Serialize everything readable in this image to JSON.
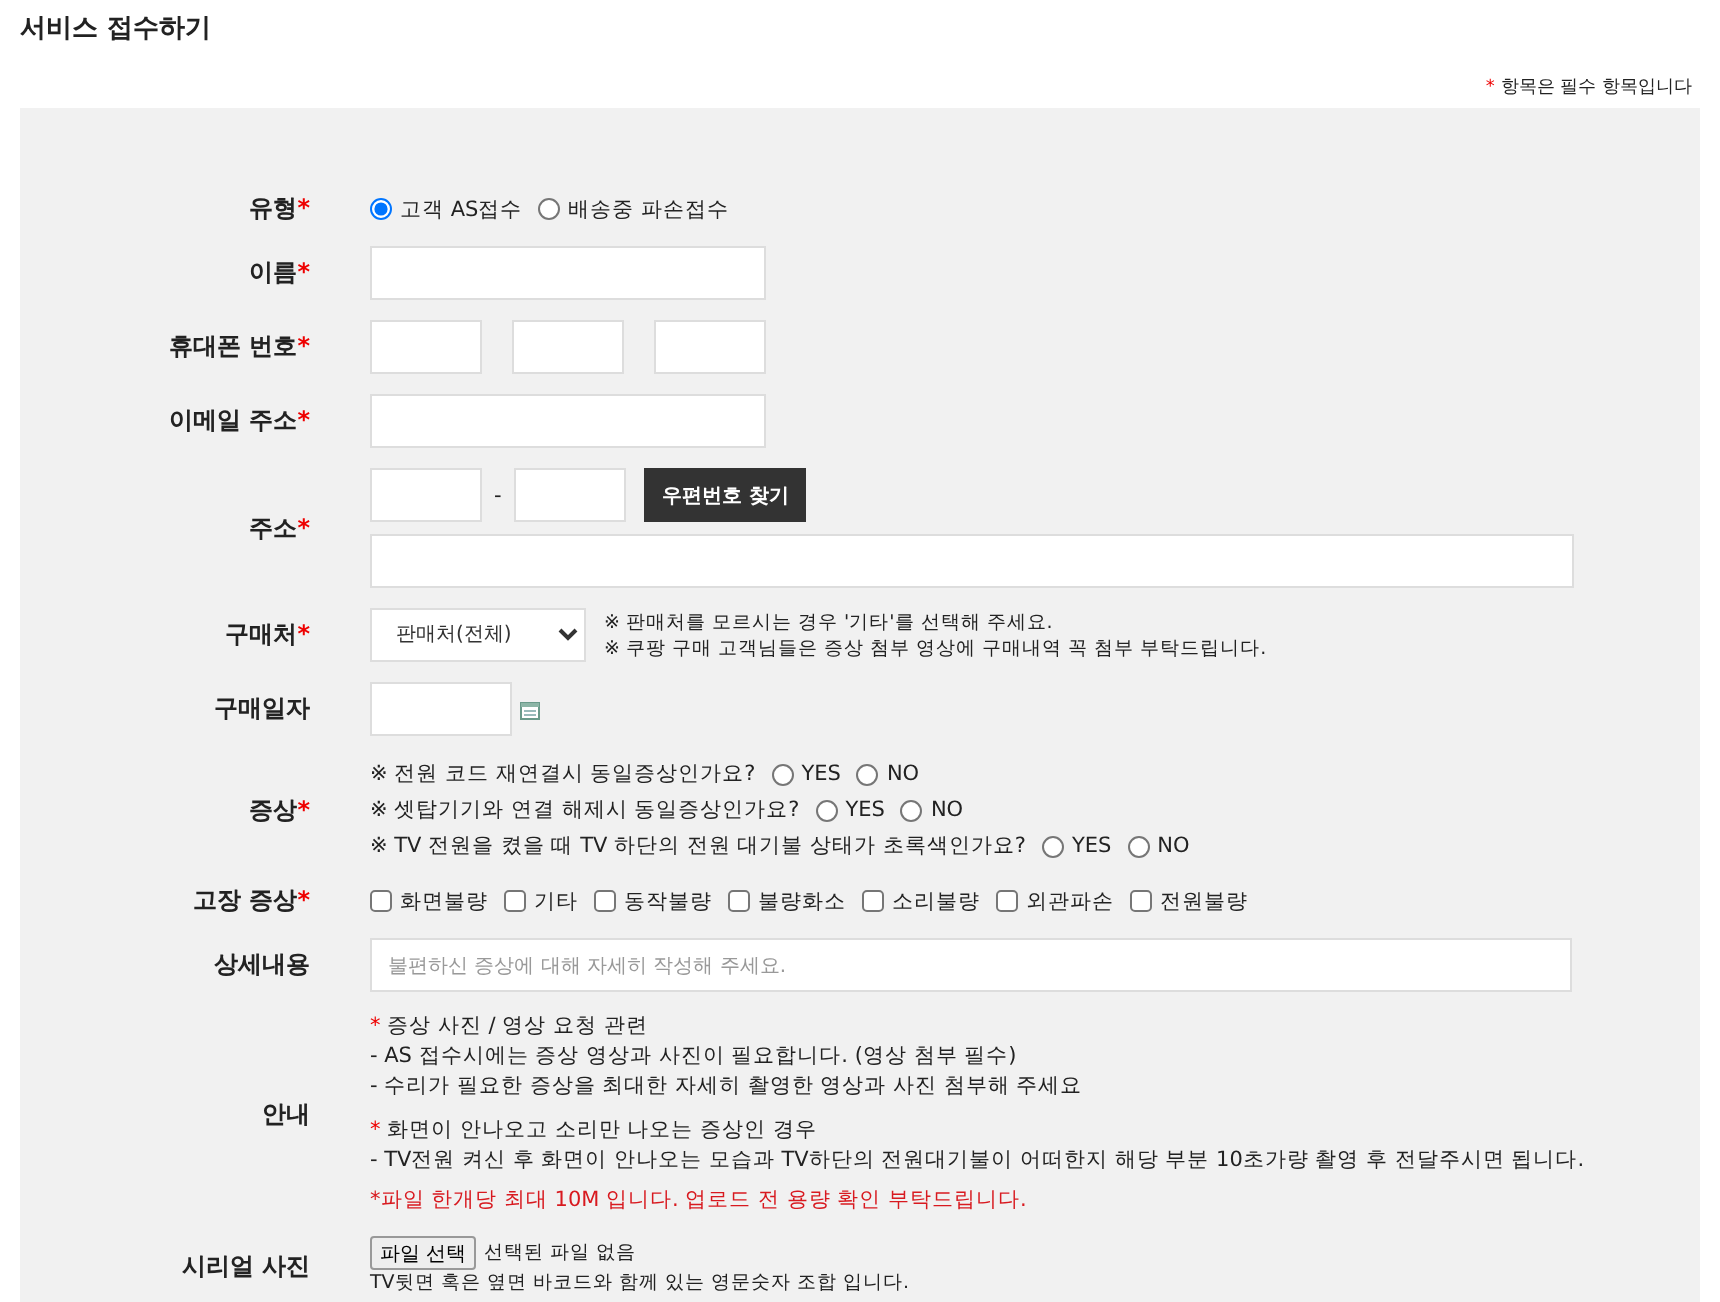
{
  "title": "서비스 접수하기",
  "required_note": {
    "mark": "*",
    "text": "항목은 필수 항목입니다"
  },
  "rows": [
    {
      "kind": "radio",
      "label": "유형",
      "mark": "*",
      "options": [
        {
          "label": "고객 AS접수",
          "selected": true
        },
        {
          "label": "배송중 파손접수",
          "selected": false
        }
      ]
    },
    {
      "kind": "text",
      "label": "이름",
      "mark": "*"
    },
    {
      "kind": "phone",
      "label": "휴대폰 번호",
      "mark": "*"
    },
    {
      "kind": "text",
      "label": "이메일 주소",
      "mark": "*"
    },
    {
      "kind": "address",
      "label": "주소",
      "mark": "*",
      "separator": "-",
      "button": "우편번호 찾기"
    },
    {
      "kind": "select",
      "label": "구매처",
      "mark": "*",
      "value": "판매처(전체)",
      "notes": [
        "※ 판매처를 모르시는 경우 '기타'를 선택해 주세요.",
        "※ 쿠팡 구매 고객님들은 증상 첨부 영상에 구매내역 꼭 첨부 부탁드립니다."
      ]
    },
    {
      "kind": "date",
      "label": "구매일자"
    },
    {
      "kind": "questions",
      "label": "증상",
      "mark": "*",
      "questions": [
        {
          "text": "※ 전원 코드 재연결시 동일증상인가요?",
          "options": [
            {
              "label": "YES",
              "selected": false
            },
            {
              "label": "NO",
              "selected": false
            }
          ]
        },
        {
          "text": "※ 셋탑기기와 연결 해제시 동일증상인가요?",
          "options": [
            {
              "label": "YES",
              "selected": false
            },
            {
              "label": "NO",
              "selected": false
            }
          ]
        },
        {
          "text": "※ TV 전원을 켰을 때 TV 하단의 전원 대기불 상태가 초록색인가요?",
          "options": [
            {
              "label": "YES",
              "selected": false
            },
            {
              "label": "NO",
              "selected": false
            }
          ]
        }
      ]
    },
    {
      "kind": "checkboxes",
      "label": "고장 증상",
      "mark": "*",
      "options": [
        {
          "label": "화면불량",
          "checked": false
        },
        {
          "label": "기타",
          "checked": false
        },
        {
          "label": "동작불량",
          "checked": false
        },
        {
          "label": "불량화소",
          "checked": false
        },
        {
          "label": "소리불량",
          "checked": false
        },
        {
          "label": "외관파손",
          "checked": false
        },
        {
          "label": "전원불량",
          "checked": false
        }
      ]
    },
    {
      "kind": "textarea",
      "label": "상세내용",
      "placeholder": "불편하신 증상에 대해 자세히 작성해 주세요."
    },
    {
      "kind": "notice",
      "label": "안내",
      "blocks": [
        {
          "mark": "*",
          "heading": "증상 사진 / 영상 요청 관련",
          "lines": [
            "- AS 접수시에는 증상 영상과 사진이 필요합니다. (영상 첨부 필수)",
            "- 수리가 필요한 증상을 최대한 자세히 촬영한 영상과 사진 첨부해 주세요"
          ]
        },
        {
          "mark": "*",
          "heading": "화면이 안나오고 소리만 나오는 증상인 경우",
          "lines": [
            "- TV전원 켜신 후 화면이 안나오는 모습과 TV하단의 전원대기불이 어떠한지 해당 부분 10초가량 촬영 후 전달주시면 됩니다."
          ]
        }
      ],
      "warning": "*파일 한개당 최대 10M 입니다. 업로드 전 용량 확인 부탁드립니다."
    },
    {
      "kind": "file",
      "label": "시리얼 사진",
      "button": "파일 선택",
      "status": "선택된 파일 없음",
      "hint": "TV뒷면 혹은 옆면 바코드와 함께 있는 영문숫자 조합 입니다."
    }
  ]
}
